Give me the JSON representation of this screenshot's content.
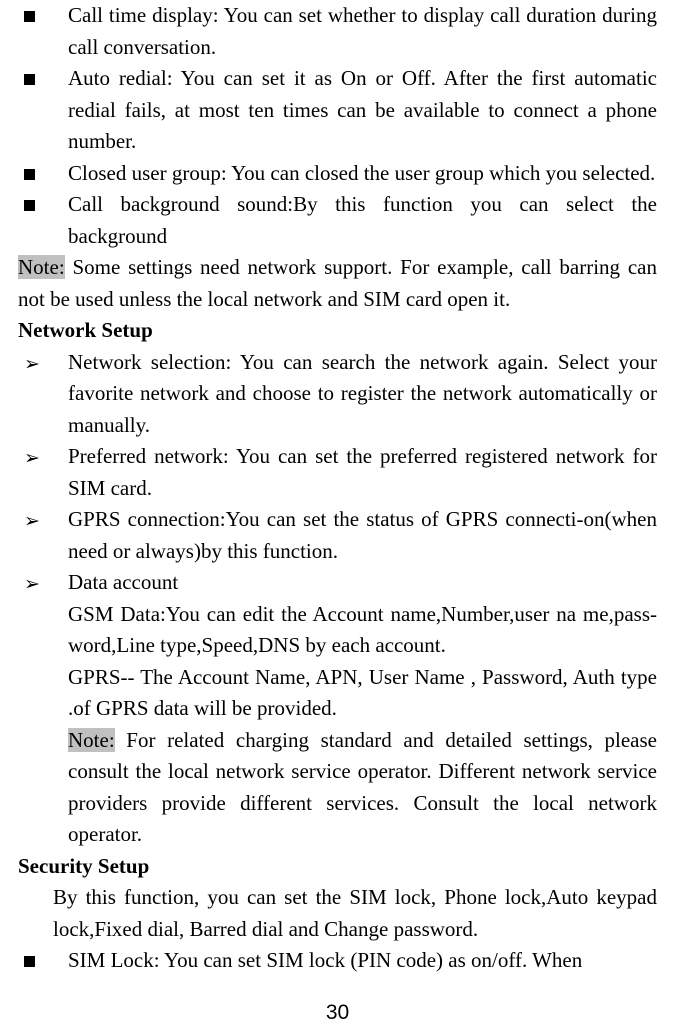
{
  "bullets_top": [
    "Call time display: You can set whether to display call duration during call conversation.",
    "Auto redial: You can set it as On or Off. After the first automatic redial fails, at most ten times can be available to connect a phone number.",
    "Closed user group: You can closed the user group which you selected.",
    "Call background sound:By this function you can select the background"
  ],
  "note1_label": "Note:",
  "note1_text": " Some settings need network support. For example, call barring can not be used unless the local network and SIM card open it.",
  "heading1": "Network Setup",
  "arrows": [
    "Network selection: You can search the network again. Select your favorite network and choose to register the network automatically or manually.",
    "Preferred network: You can set the preferred registered network for SIM card.",
    "GPRS connection:You can set the status of GPRS connecti-on(when need or always)by this function.",
    "Data account"
  ],
  "gsm_text": "GSM Data:You can edit the Account name,Number,user na me,pass-word,Line type,Speed,DNS by each account.",
  "gprs_text": "GPRS-- The Account Name, APN, User Name , Password,  Auth type .of GPRS data will be provided.",
  "note2_label": "Note:",
  "note2_text": " For related charging standard and detailed settings, please consult the local network service operator. Different network service providers provide different services. Consult the local network operator.",
  "heading2": "Security Setup",
  "security_intro": "By this function, you can set the SIM lock, Phone lock,Auto keypad lock,Fixed dial, Barred dial and Change password.",
  "sim_lock": "SIM Lock: You can set SIM lock (PIN code) as on/off. When",
  "page_number": "30"
}
